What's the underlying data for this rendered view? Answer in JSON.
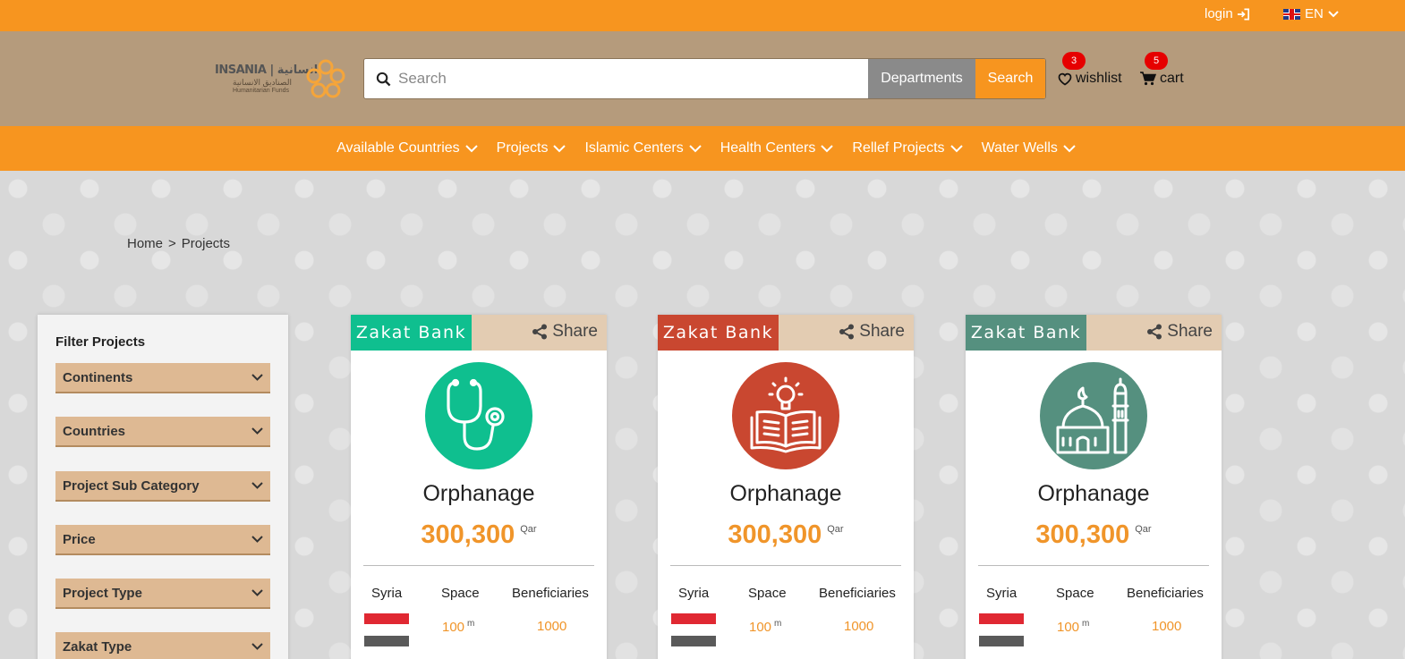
{
  "topbar": {
    "login_label": "login",
    "lang_label": "EN"
  },
  "header": {
    "logo_text": "INSANIA | انسانية",
    "logo_sub_ar": "الصناديق الانسانية",
    "logo_sub_en": "Humanitarian Funds",
    "search_placeholder": "Search",
    "departments_label": "Departments",
    "search_button": "Search",
    "wishlist_label": "wishlist",
    "wishlist_count": "3",
    "cart_label": "cart",
    "cart_count": "5"
  },
  "nav": {
    "items": [
      {
        "label": "Available Countries"
      },
      {
        "label": "Projects"
      },
      {
        "label": "Islamic Centers"
      },
      {
        "label": "Health Centers"
      },
      {
        "label": "Rellef Projects"
      },
      {
        "label": "Water Wells"
      }
    ]
  },
  "breadcrumb": {
    "home": "Home",
    "separator": ">",
    "current": "Projects"
  },
  "filter": {
    "title": "Filter Projects",
    "items": [
      {
        "label": "Continents"
      },
      {
        "label": "Countries"
      },
      {
        "label": "Project Sub Category"
      },
      {
        "label": "Price"
      },
      {
        "label": "Project Type"
      },
      {
        "label": "Zakat Type"
      }
    ]
  },
  "cards": [
    {
      "tag": "Zakat Bank",
      "tag_color": "#0fbf8f",
      "share": "Share",
      "icon": "stethoscope-icon",
      "circle_color": "#0fbf8f",
      "title": "Orphanage",
      "price": "300,300",
      "currency": "Qar",
      "country_label": "Syria",
      "space_label": "Space",
      "space_value": "100",
      "space_unit": "m",
      "beneficiaries_label": "Beneficiaries",
      "beneficiaries_value": "1000"
    },
    {
      "tag": "Zakat Bank",
      "tag_color": "#c94730",
      "share": "Share",
      "icon": "book-bulb-icon",
      "circle_color": "#c94730",
      "title": "Orphanage",
      "price": "300,300",
      "currency": "Qar",
      "country_label": "Syria",
      "space_label": "Space",
      "space_value": "100",
      "space_unit": "m",
      "beneficiaries_label": "Beneficiaries",
      "beneficiaries_value": "1000"
    },
    {
      "tag": "Zakat Bank",
      "tag_color": "#55907f",
      "share": "Share",
      "icon": "mosque-icon",
      "circle_color": "#55907f",
      "title": "Orphanage",
      "price": "300,300",
      "currency": "Qar",
      "country_label": "Syria",
      "space_label": "Space",
      "space_value": "100",
      "space_unit": "m",
      "beneficiaries_label": "Beneficiaries",
      "beneficiaries_value": "1000"
    }
  ],
  "colors": {
    "accent": "#f7951f",
    "header_bg": "#b59b7c",
    "filter_item_bg": "#deb993",
    "price_color": "#f0952a",
    "badge": "#e60000"
  }
}
